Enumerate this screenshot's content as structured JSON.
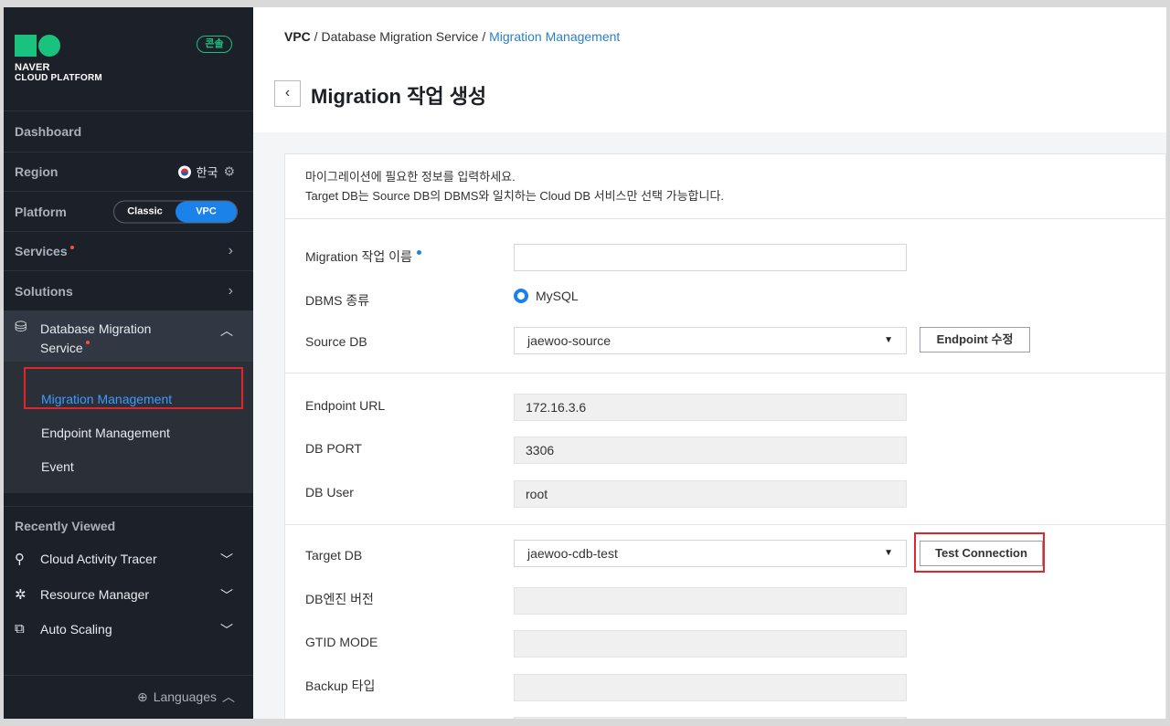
{
  "sidebar": {
    "logo": {
      "line1": "NAVER",
      "line2": "CLOUD PLATFORM"
    },
    "console_badge": "콘솔",
    "dashboard": "Dashboard",
    "region": {
      "label": "Region",
      "value": "한국"
    },
    "platform": {
      "label": "Platform",
      "options": [
        "Classic",
        "VPC"
      ],
      "selected": "VPC"
    },
    "services": "Services",
    "solutions": "Solutions",
    "dms": {
      "title": "Database Migration Service",
      "items": [
        "Migration Management",
        "Endpoint Management",
        "Event"
      ],
      "active": "Migration Management"
    },
    "recently_viewed": {
      "title": "Recently Viewed",
      "items": [
        "Cloud Activity Tracer",
        "Resource Manager",
        "Auto Scaling"
      ]
    },
    "languages": "Languages"
  },
  "breadcrumb": [
    "VPC",
    "Database Migration Service",
    "Migration Management"
  ],
  "page_title": "Migration 작업 생성",
  "intro": {
    "line1": "마이그레이션에 필요한 정보를 입력하세요.",
    "line2": "Target DB는 Source DB의 DBMS와 일치하는 Cloud DB 서비스만 선택 가능합니다."
  },
  "form": {
    "job_name": {
      "label": "Migration 작업 이름",
      "value": ""
    },
    "dbms": {
      "label": "DBMS 종류",
      "value": "MySQL"
    },
    "source_db": {
      "label": "Source DB",
      "value": "jaewoo-source",
      "button": "Endpoint 수정"
    },
    "endpoint_url": {
      "label": "Endpoint URL",
      "value": "172.16.3.6"
    },
    "db_port": {
      "label": "DB PORT",
      "value": "3306"
    },
    "db_user": {
      "label": "DB User",
      "value": "root"
    },
    "target_db": {
      "label": "Target DB",
      "value": "jaewoo-cdb-test",
      "button": "Test Connection"
    },
    "engine_version": {
      "label": "DB엔진 버전",
      "value": ""
    },
    "gtid_mode": {
      "label": "GTID MODE",
      "value": ""
    },
    "backup_type": {
      "label": "Backup 타입",
      "value": ""
    }
  },
  "colors": {
    "accent": "#1a82e8",
    "highlight": "#e0262b",
    "brand": "#19c37d"
  }
}
